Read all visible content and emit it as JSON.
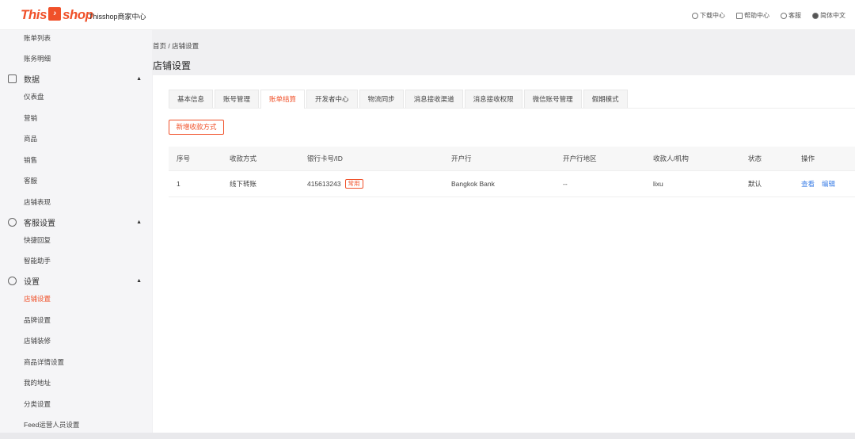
{
  "header": {
    "logo": "Thisshop",
    "app_title": "Thisshop商家中心",
    "nav": [
      {
        "icon": "download-cloud-icon",
        "label": "下载中心"
      },
      {
        "icon": "help-doc-icon",
        "label": "帮助中心"
      },
      {
        "icon": "headset-icon",
        "label": "客服"
      },
      {
        "icon": "globe-icon",
        "label": "简体中文"
      }
    ]
  },
  "sidebar": {
    "items_top": [
      "账单列表",
      "账务明细"
    ],
    "groups": [
      {
        "label": "数据",
        "icon": "chart-icon",
        "items": [
          "仪表盘",
          "营销",
          "商品",
          "销售",
          "客服",
          "店铺表现"
        ]
      },
      {
        "label": "客服设置",
        "icon": "headset-icon",
        "items": [
          "快捷回复",
          "智能助手"
        ]
      },
      {
        "label": "设置",
        "icon": "settings-icon",
        "items": [
          "店铺设置",
          "品牌设置",
          "店铺装修",
          "商品详情设置",
          "我的地址",
          "分类设置",
          "Feed运营人员设置"
        ]
      }
    ],
    "active": "店铺设置"
  },
  "breadcrumb": {
    "home": "首页",
    "sep": "/",
    "current": "店铺设置"
  },
  "page_title": "店铺设置",
  "tabs": [
    "基本信息",
    "账号管理",
    "账单结算",
    "开发者中心",
    "物流同步",
    "消息接收渠道",
    "消息接收权限",
    "微信账号管理",
    "假期模式"
  ],
  "active_tab": "账单结算",
  "add_button": "新增收款方式",
  "table": {
    "columns": [
      "序号",
      "收款方式",
      "银行卡号/ID",
      "开户行",
      "开户行地区",
      "收款人/机构",
      "状态",
      "操作"
    ],
    "rows": [
      {
        "index": "1",
        "method": "线下转账",
        "account": "415613243",
        "tag": "常用",
        "bank": "Bangkok Bank",
        "region": "--",
        "payee": "lixu",
        "status": "默认",
        "actions": [
          "查看",
          "编辑"
        ]
      }
    ]
  },
  "colors": {
    "accent": "#f0512a",
    "link": "#3b7ee6"
  }
}
